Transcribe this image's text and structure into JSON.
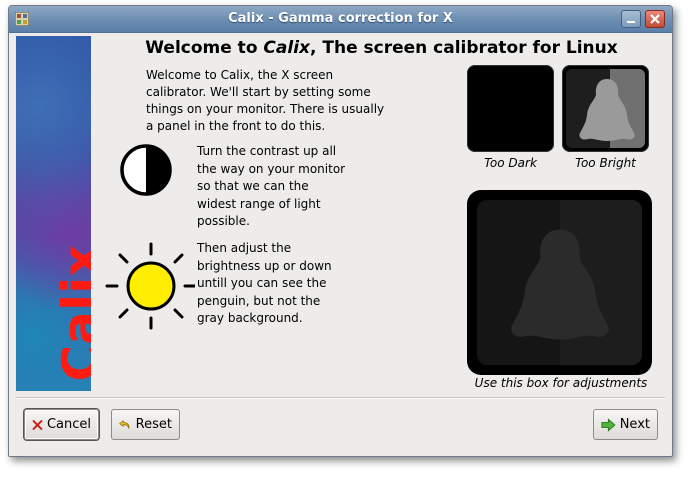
{
  "window": {
    "title": "Calix - Gamma correction for X",
    "minimize_label": "minimize",
    "close_label": "close"
  },
  "sidebar": {
    "logo_text": "Calix"
  },
  "main": {
    "heading_prefix": "Welcome to ",
    "heading_app": "Calix",
    "heading_suffix": ", The screen calibrator for Linux",
    "intro": "Welcome to Calix, the X screen calibrator. We'll start by setting some things on your monitor.  There is usually a panel in the front to do this.",
    "step_contrast": "Turn the contrast up all the way on your monitor so that we can the widest range of light possible.",
    "step_brightness": "Then adjust the brightness up or down untill you can see the penguin, but not the gray background."
  },
  "preview": {
    "too_dark_caption": "Too Dark",
    "too_bright_caption": "Too Bright",
    "adjust_caption": "Use this box for adjustments"
  },
  "buttons": {
    "cancel": "Cancel",
    "reset": "Reset",
    "next": "Next"
  },
  "colors": {
    "sun": "#ffee00",
    "logo": "#ff1a12",
    "title_bar": "#6b8db2"
  }
}
